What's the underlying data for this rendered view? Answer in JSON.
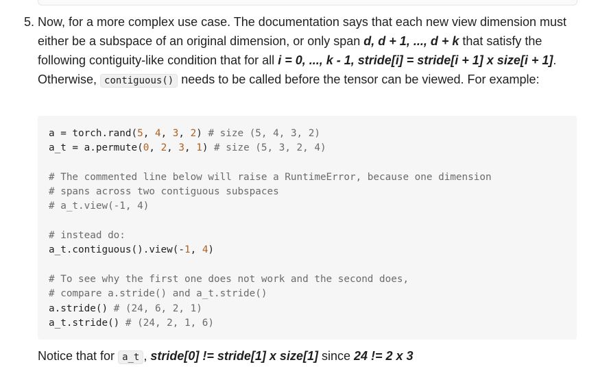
{
  "item": {
    "number": "5.",
    "para1": {
      "t1": "Now, for a more complex use case. The documentation says that each new view dimension must either be a subspace of an original dimension, or only span ",
      "b1": "d, d + 1, ..., d + k",
      "t2": " that satisfy the following contiguity-like condition that for all ",
      "b2": "i = 0, ..., k - 1, stride[i] = stride[i + 1] x size[i + 1]",
      "t3": ". Otherwise, ",
      "code1": "contiguous()",
      "t4": " needs to be called before the tensor can be viewed. For example:"
    }
  },
  "code_lines": [
    {
      "a": "a = torch.rand(",
      "n1": "5",
      "b": ", ",
      "n2": "4",
      "c": ", ",
      "n3": "3",
      "d": ", ",
      "n4": "2",
      "e": ") ",
      "comment": "# size (5, 4, 3, 2)"
    },
    {
      "a": "a_t = a.permute(",
      "n1": "0",
      "b": ", ",
      "n2": "2",
      "c": ", ",
      "n3": "3",
      "d": ", ",
      "n4": "1",
      "e": ") ",
      "comment": "# size (5, 3, 2, 4)"
    },
    {
      "comment": ""
    },
    {
      "comment": "# The commented line below will raise a RuntimeError, because one dimension"
    },
    {
      "comment": "# spans across two contiguous subspaces"
    },
    {
      "comment": "# a_t.view(-1, 4)"
    },
    {
      "comment": ""
    },
    {
      "comment": "# instead do:"
    },
    {
      "a": "a_t.contiguous().view(-",
      "n1": "1",
      "b": ", ",
      "n2": "4",
      "e": ")"
    },
    {
      "comment": ""
    },
    {
      "comment": "# To see why the first one does not work and the second does,"
    },
    {
      "comment": "# compare a.stride() and a_t.stride()"
    },
    {
      "a": "a.stride() ",
      "comment": "# (24, 6, 2, 1)"
    },
    {
      "a": "a_t.stride() ",
      "comment": "# (24, 2, 1, 6)"
    }
  ],
  "notice": {
    "t1": "Notice that for ",
    "code": "a_t",
    "t2": ", ",
    "b1": "stride[0] != stride[1] x size[1]",
    "t3": " since ",
    "b2": "24 != 2 x 3"
  }
}
